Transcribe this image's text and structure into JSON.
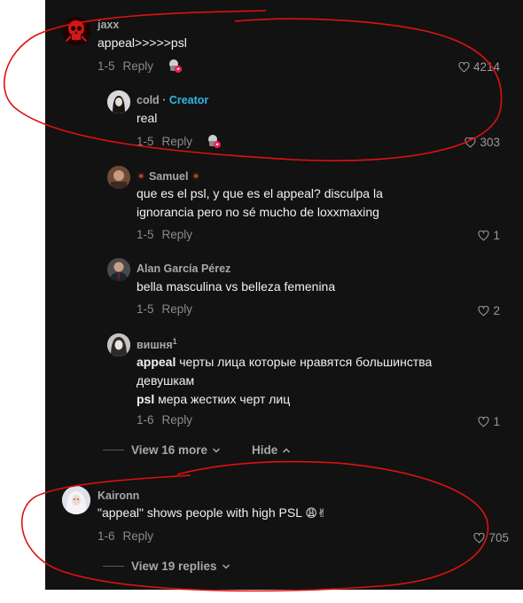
{
  "comments": [
    {
      "username": "jaxx",
      "text": "appeal>>>>>psl",
      "date": "1-5",
      "reply": "Reply",
      "likes": "4214"
    },
    {
      "username": "cold",
      "creator_sep": " · ",
      "creator": "Creator",
      "text": "real",
      "date": "1-5",
      "reply": "Reply",
      "likes": "303"
    },
    {
      "username_prefix": "✴",
      "username": "Samuel",
      "username_suffix": "✴",
      "text": "que es el psl, y que es el appeal? disculpa la ignorancia pero no sé mucho de loxxmaxing",
      "date": "1-5",
      "reply": "Reply",
      "likes": "1"
    },
    {
      "username": "Alan García Pérez",
      "text": "bella masculina vs belleza femenina",
      "date": "1-5",
      "reply": "Reply",
      "likes": "2"
    },
    {
      "username": "вишня",
      "username_sup": "1",
      "text_bold1": "appeal",
      "text_rest1": " черты лица которые нравятся большинства девушкам",
      "text_bold2": "psl",
      "text_rest2": " мера жестких черт лиц",
      "date": "1-6",
      "reply": "Reply",
      "likes": "1"
    },
    {
      "username": "Kaironn",
      "text": "\"appeal\" shows people with high PSL",
      "emoji": "😩✌",
      "date": "1-6",
      "reply": "Reply",
      "likes": "705"
    }
  ],
  "thread": {
    "view_more": "View 16 more",
    "hide": "Hide",
    "view_replies": "View 19 replies"
  },
  "icons": {
    "heart": "heart-outline-icon",
    "chevron": "chevron-down-icon",
    "chevron_up": "chevron-up-icon",
    "creator_like": "creator-liked-icon"
  },
  "colors": {
    "panel_bg": "#121212",
    "creator": "#2fb6e8",
    "annotation": "#e01010"
  }
}
